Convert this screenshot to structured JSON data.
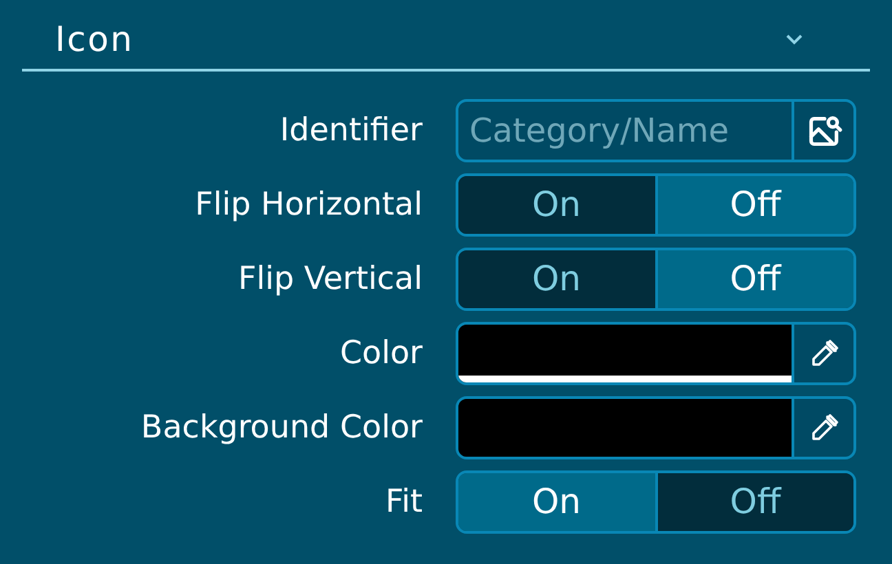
{
  "section": {
    "title": "Icon",
    "expanded": true
  },
  "rows": [
    {
      "kind": "text",
      "label": "Identifier",
      "placeholder": "Category/Name"
    },
    {
      "kind": "toggle",
      "label": "Flip Horizontal",
      "options": [
        {
          "label": "On",
          "selected": false
        },
        {
          "label": "Off",
          "selected": true
        }
      ]
    },
    {
      "kind": "toggle",
      "label": "Flip Vertical",
      "options": [
        {
          "label": "On",
          "selected": false
        },
        {
          "label": "Off",
          "selected": true
        }
      ]
    },
    {
      "kind": "color",
      "label": "Color",
      "color": "#000000",
      "level": 1
    },
    {
      "kind": "color",
      "label": "Background Color",
      "color": "#000000",
      "level": 0
    },
    {
      "kind": "toggle",
      "label": "Fit",
      "options": [
        {
          "label": "On",
          "selected": true
        },
        {
          "label": "Off",
          "selected": false
        }
      ]
    }
  ]
}
